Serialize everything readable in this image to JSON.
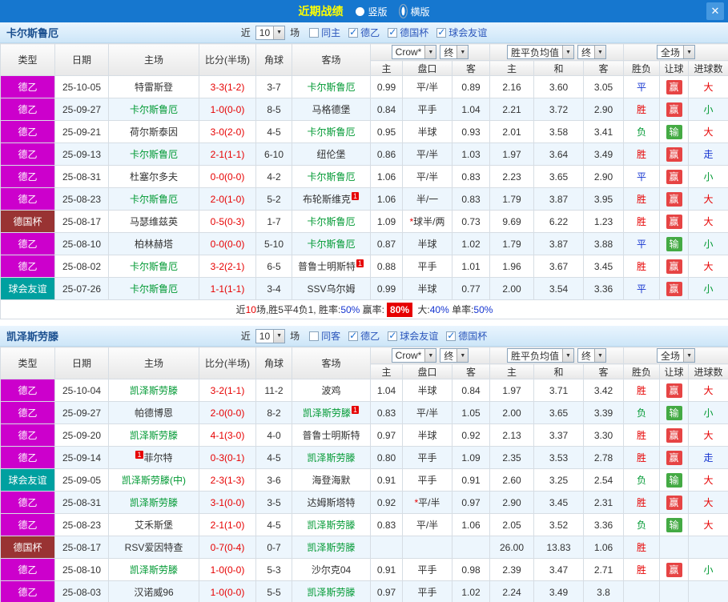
{
  "topbar": {
    "title": "近期战绩",
    "radio_options": [
      {
        "label": "竖版",
        "selected": false
      },
      {
        "label": "横版",
        "selected": true
      }
    ],
    "close_label": "✕"
  },
  "filter": {
    "near": "近",
    "count": "10",
    "games": "场"
  },
  "columns": {
    "type": "类型",
    "date": "日期",
    "home": "主场",
    "score": "比分(半场)",
    "corner": "角球",
    "away": "客场",
    "odds_company": "Crow*",
    "final": "终",
    "odds_home": "主",
    "handicap": "盘口",
    "odds_away": "客",
    "avg_label": "胜平负均值",
    "avg_home": "主",
    "avg_draw": "和",
    "avg_away": "客",
    "scope": "全场",
    "result": "胜负",
    "let_col": "让球",
    "goals": "进球数"
  },
  "colors": {
    "topbar-bg": "#1677cf",
    "title-yellow": "#ffff00",
    "league-magenta": "#cc00cc",
    "cup-maroon": "#993333",
    "friendly-teal": "#00a0a0",
    "focus-green": "#009933",
    "score-red": "#e60000",
    "win-red": "#e64444",
    "lose-green": "#44aa44",
    "text-blue": "#1535d0",
    "teambar-blue": "#1a4f8f"
  },
  "sections": [
    {
      "team": "卡尔斯鲁厄",
      "checkboxes": [
        {
          "label": "同主",
          "checked": false
        },
        {
          "label": "德乙",
          "checked": true
        },
        {
          "label": "德国杯",
          "checked": true
        },
        {
          "label": "球会友谊",
          "checked": true
        }
      ],
      "rows": [
        {
          "type": "德乙",
          "date": "25-10-05",
          "home": {
            "text": "特雷斯登",
            "focus": false,
            "badge": "",
            "badge_pos": ""
          },
          "score": "3-3(1-2)",
          "corner": "3-7",
          "away": {
            "text": "卡尔斯鲁厄",
            "focus": true,
            "badge": "",
            "badge_pos": ""
          },
          "odds": [
            "0.99",
            "平/半",
            "0.89"
          ],
          "avg": [
            "2.16",
            "3.60",
            "3.05"
          ],
          "result": {
            "text": "平",
            "color": "blue"
          },
          "let": {
            "text": "赢",
            "color": "red"
          },
          "goal": {
            "text": "大",
            "color": "red"
          }
        },
        {
          "type": "德乙",
          "date": "25-09-27",
          "home": {
            "text": "卡尔斯鲁厄",
            "focus": true,
            "badge": "",
            "badge_pos": ""
          },
          "score": "1-0(0-0)",
          "corner": "8-5",
          "away": {
            "text": "马格德堡",
            "focus": false,
            "badge": "",
            "badge_pos": ""
          },
          "odds": [
            "0.84",
            "平手",
            "1.04"
          ],
          "avg": [
            "2.21",
            "3.72",
            "2.90"
          ],
          "result": {
            "text": "胜",
            "color": "red"
          },
          "let": {
            "text": "赢",
            "color": "red"
          },
          "goal": {
            "text": "小",
            "color": "green"
          }
        },
        {
          "type": "德乙",
          "date": "25-09-21",
          "home": {
            "text": "荷尔斯泰因",
            "focus": false,
            "badge": "",
            "badge_pos": ""
          },
          "score": "3-0(2-0)",
          "corner": "4-5",
          "away": {
            "text": "卡尔斯鲁厄",
            "focus": true,
            "badge": "",
            "badge_pos": ""
          },
          "odds": [
            "0.95",
            "半球",
            "0.93"
          ],
          "avg": [
            "2.01",
            "3.58",
            "3.41"
          ],
          "result": {
            "text": "负",
            "color": "green"
          },
          "let": {
            "text": "输",
            "color": "green"
          },
          "goal": {
            "text": "大",
            "color": "red"
          }
        },
        {
          "type": "德乙",
          "date": "25-09-13",
          "home": {
            "text": "卡尔斯鲁厄",
            "focus": true,
            "badge": "",
            "badge_pos": ""
          },
          "score": "2-1(1-1)",
          "corner": "6-10",
          "away": {
            "text": "纽伦堡",
            "focus": false,
            "badge": "",
            "badge_pos": ""
          },
          "odds": [
            "0.86",
            "平/半",
            "1.03"
          ],
          "avg": [
            "1.97",
            "3.64",
            "3.49"
          ],
          "result": {
            "text": "胜",
            "color": "red"
          },
          "let": {
            "text": "赢",
            "color": "red"
          },
          "goal": {
            "text": "走",
            "color": "blue"
          }
        },
        {
          "type": "德乙",
          "date": "25-08-31",
          "home": {
            "text": "杜塞尔多夫",
            "focus": false,
            "badge": "",
            "badge_pos": ""
          },
          "score": "0-0(0-0)",
          "corner": "4-2",
          "away": {
            "text": "卡尔斯鲁厄",
            "focus": true,
            "badge": "",
            "badge_pos": ""
          },
          "odds": [
            "1.06",
            "平/半",
            "0.83"
          ],
          "avg": [
            "2.23",
            "3.65",
            "2.90"
          ],
          "result": {
            "text": "平",
            "color": "blue"
          },
          "let": {
            "text": "赢",
            "color": "red"
          },
          "goal": {
            "text": "小",
            "color": "green"
          }
        },
        {
          "type": "德乙",
          "date": "25-08-23",
          "home": {
            "text": "卡尔斯鲁厄",
            "focus": true,
            "badge": "",
            "badge_pos": ""
          },
          "score": "2-0(1-0)",
          "corner": "5-2",
          "away": {
            "text": "布轮斯维克",
            "focus": false,
            "badge": "1",
            "badge_pos": "after"
          },
          "odds": [
            "1.06",
            "半/一",
            "0.83"
          ],
          "avg": [
            "1.79",
            "3.87",
            "3.95"
          ],
          "result": {
            "text": "胜",
            "color": "red"
          },
          "let": {
            "text": "赢",
            "color": "red"
          },
          "goal": {
            "text": "大",
            "color": "red"
          }
        },
        {
          "type": "德国杯",
          "date": "25-08-17",
          "home": {
            "text": "马瑟维兹英",
            "focus": false,
            "badge": "",
            "badge_pos": ""
          },
          "score": "0-5(0-3)",
          "corner": "1-7",
          "away": {
            "text": "卡尔斯鲁厄",
            "focus": true,
            "badge": "",
            "badge_pos": ""
          },
          "odds": [
            "1.09",
            "*球半/两",
            "0.73"
          ],
          "avg": [
            "9.69",
            "6.22",
            "1.23"
          ],
          "result": {
            "text": "胜",
            "color": "red"
          },
          "let": {
            "text": "赢",
            "color": "red"
          },
          "goal": {
            "text": "大",
            "color": "red"
          }
        },
        {
          "type": "德乙",
          "date": "25-08-10",
          "home": {
            "text": "柏林赫塔",
            "focus": false,
            "badge": "",
            "badge_pos": ""
          },
          "score": "0-0(0-0)",
          "corner": "5-10",
          "away": {
            "text": "卡尔斯鲁厄",
            "focus": true,
            "badge": "",
            "badge_pos": ""
          },
          "odds": [
            "0.87",
            "半球",
            "1.02"
          ],
          "avg": [
            "1.79",
            "3.87",
            "3.88"
          ],
          "result": {
            "text": "平",
            "color": "blue"
          },
          "let": {
            "text": "输",
            "color": "green"
          },
          "goal": {
            "text": "小",
            "color": "green"
          }
        },
        {
          "type": "德乙",
          "date": "25-08-02",
          "home": {
            "text": "卡尔斯鲁厄",
            "focus": true,
            "badge": "",
            "badge_pos": ""
          },
          "score": "3-2(2-1)",
          "corner": "6-5",
          "away": {
            "text": "普鲁士明斯特",
            "focus": false,
            "badge": "1",
            "badge_pos": "after"
          },
          "odds": [
            "0.88",
            "平手",
            "1.01"
          ],
          "avg": [
            "1.96",
            "3.67",
            "3.45"
          ],
          "result": {
            "text": "胜",
            "color": "red"
          },
          "let": {
            "text": "赢",
            "color": "red"
          },
          "goal": {
            "text": "大",
            "color": "red"
          }
        },
        {
          "type": "球会友谊",
          "date": "25-07-26",
          "home": {
            "text": "卡尔斯鲁厄",
            "focus": true,
            "badge": "",
            "badge_pos": ""
          },
          "score": "1-1(1-1)",
          "corner": "3-4",
          "away": {
            "text": "SSV乌尔姆",
            "focus": false,
            "badge": "",
            "badge_pos": ""
          },
          "odds": [
            "0.99",
            "半球",
            "0.77"
          ],
          "avg": [
            "2.00",
            "3.54",
            "3.36"
          ],
          "result": {
            "text": "平",
            "color": "blue"
          },
          "let": {
            "text": "赢",
            "color": "red"
          },
          "goal": {
            "text": "小",
            "color": "green"
          }
        }
      ],
      "summary": [
        {
          "text": "近",
          "style": "plain"
        },
        {
          "text": "10",
          "style": "red"
        },
        {
          "text": "场,胜5平4负1, 胜率:",
          "style": "plain"
        },
        {
          "text": "50%",
          "style": "blue"
        },
        {
          "text": " 赢率:",
          "style": "plain"
        },
        {
          "text": "80%",
          "style": "red-badge"
        },
        {
          "text": " 大:",
          "style": "plain"
        },
        {
          "text": "40%",
          "style": "blue"
        },
        {
          "text": " 单率:",
          "style": "plain"
        },
        {
          "text": "50%",
          "style": "blue"
        }
      ]
    },
    {
      "team": "凯泽斯劳滕",
      "checkboxes": [
        {
          "label": "同客",
          "checked": false
        },
        {
          "label": "德乙",
          "checked": true
        },
        {
          "label": "球会友谊",
          "checked": true
        },
        {
          "label": "德国杯",
          "checked": true
        }
      ],
      "rows": [
        {
          "type": "德乙",
          "date": "25-10-04",
          "home": {
            "text": "凯泽斯劳滕",
            "focus": true,
            "badge": "",
            "badge_pos": ""
          },
          "score": "3-2(1-1)",
          "corner": "11-2",
          "away": {
            "text": "波鸡",
            "focus": false,
            "badge": "",
            "badge_pos": ""
          },
          "odds": [
            "1.04",
            "半球",
            "0.84"
          ],
          "avg": [
            "1.97",
            "3.71",
            "3.42"
          ],
          "result": {
            "text": "胜",
            "color": "red"
          },
          "let": {
            "text": "赢",
            "color": "red"
          },
          "goal": {
            "text": "大",
            "color": "red"
          }
        },
        {
          "type": "德乙",
          "date": "25-09-27",
          "home": {
            "text": "帕德博恩",
            "focus": false,
            "badge": "",
            "badge_pos": ""
          },
          "score": "2-0(0-0)",
          "corner": "8-2",
          "away": {
            "text": "凯泽斯劳滕",
            "focus": true,
            "badge": "1",
            "badge_pos": "after"
          },
          "odds": [
            "0.83",
            "平/半",
            "1.05"
          ],
          "avg": [
            "2.00",
            "3.65",
            "3.39"
          ],
          "result": {
            "text": "负",
            "color": "green"
          },
          "let": {
            "text": "输",
            "color": "green"
          },
          "goal": {
            "text": "小",
            "color": "green"
          }
        },
        {
          "type": "德乙",
          "date": "25-09-20",
          "home": {
            "text": "凯泽斯劳滕",
            "focus": true,
            "badge": "",
            "badge_pos": ""
          },
          "score": "4-1(3-0)",
          "corner": "4-0",
          "away": {
            "text": "普鲁士明斯特",
            "focus": false,
            "badge": "",
            "badge_pos": ""
          },
          "odds": [
            "0.97",
            "半球",
            "0.92"
          ],
          "avg": [
            "2.13",
            "3.37",
            "3.30"
          ],
          "result": {
            "text": "胜",
            "color": "red"
          },
          "let": {
            "text": "赢",
            "color": "red"
          },
          "goal": {
            "text": "大",
            "color": "red"
          }
        },
        {
          "type": "德乙",
          "date": "25-09-14",
          "home": {
            "text": "菲尔特",
            "focus": false,
            "badge": "1",
            "badge_pos": "before"
          },
          "score": "0-3(0-1)",
          "corner": "4-5",
          "away": {
            "text": "凯泽斯劳滕",
            "focus": true,
            "badge": "",
            "badge_pos": ""
          },
          "odds": [
            "0.80",
            "平手",
            "1.09"
          ],
          "avg": [
            "2.35",
            "3.53",
            "2.78"
          ],
          "result": {
            "text": "胜",
            "color": "red"
          },
          "let": {
            "text": "赢",
            "color": "red"
          },
          "goal": {
            "text": "走",
            "color": "blue"
          }
        },
        {
          "type": "球会友谊",
          "date": "25-09-05",
          "home": {
            "text": "凯泽斯劳滕(中)",
            "focus": true,
            "badge": "",
            "badge_pos": ""
          },
          "score": "2-3(1-3)",
          "corner": "3-6",
          "away": {
            "text": "海登海默",
            "focus": false,
            "badge": "",
            "badge_pos": ""
          },
          "odds": [
            "0.91",
            "平手",
            "0.91"
          ],
          "avg": [
            "2.60",
            "3.25",
            "2.54"
          ],
          "result": {
            "text": "负",
            "color": "green"
          },
          "let": {
            "text": "输",
            "color": "green"
          },
          "goal": {
            "text": "大",
            "color": "red"
          }
        },
        {
          "type": "德乙",
          "date": "25-08-31",
          "home": {
            "text": "凯泽斯劳滕",
            "focus": true,
            "badge": "",
            "badge_pos": ""
          },
          "score": "3-1(0-0)",
          "corner": "3-5",
          "away": {
            "text": "达姆斯塔特",
            "focus": false,
            "badge": "",
            "badge_pos": ""
          },
          "odds": [
            "0.92",
            "*平/半",
            "0.97"
          ],
          "avg": [
            "2.90",
            "3.45",
            "2.31"
          ],
          "result": {
            "text": "胜",
            "color": "red"
          },
          "let": {
            "text": "赢",
            "color": "red"
          },
          "goal": {
            "text": "大",
            "color": "red"
          }
        },
        {
          "type": "德乙",
          "date": "25-08-23",
          "home": {
            "text": "艾禾斯堡",
            "focus": false,
            "badge": "",
            "badge_pos": ""
          },
          "score": "2-1(1-0)",
          "corner": "4-5",
          "away": {
            "text": "凯泽斯劳滕",
            "focus": true,
            "badge": "",
            "badge_pos": ""
          },
          "odds": [
            "0.83",
            "平/半",
            "1.06"
          ],
          "avg": [
            "2.05",
            "3.52",
            "3.36"
          ],
          "result": {
            "text": "负",
            "color": "green"
          },
          "let": {
            "text": "输",
            "color": "green"
          },
          "goal": {
            "text": "大",
            "color": "red"
          }
        },
        {
          "type": "德国杯",
          "date": "25-08-17",
          "home": {
            "text": "RSV爱因特查",
            "focus": false,
            "badge": "",
            "badge_pos": ""
          },
          "score": "0-7(0-4)",
          "corner": "0-7",
          "away": {
            "text": "凯泽斯劳滕",
            "focus": true,
            "badge": "",
            "badge_pos": ""
          },
          "odds": [
            "",
            "",
            ""
          ],
          "avg": [
            "26.00",
            "13.83",
            "1.06"
          ],
          "result": {
            "text": "胜",
            "color": "red"
          },
          "let": {
            "text": "",
            "color": ""
          },
          "goal": {
            "text": "",
            "color": ""
          }
        },
        {
          "type": "德乙",
          "date": "25-08-10",
          "home": {
            "text": "凯泽斯劳滕",
            "focus": true,
            "badge": "",
            "badge_pos": ""
          },
          "score": "1-0(0-0)",
          "corner": "5-3",
          "away": {
            "text": "沙尔克04",
            "focus": false,
            "badge": "",
            "badge_pos": ""
          },
          "odds": [
            "0.91",
            "平手",
            "0.98"
          ],
          "avg": [
            "2.39",
            "3.47",
            "2.71"
          ],
          "result": {
            "text": "胜",
            "color": "red"
          },
          "let": {
            "text": "赢",
            "color": "red"
          },
          "goal": {
            "text": "小",
            "color": "green"
          }
        },
        {
          "type": "德乙",
          "date": "25-08-03",
          "home": {
            "text": "汉诺威96",
            "focus": false,
            "badge": "",
            "badge_pos": ""
          },
          "score": "1-0(0-0)",
          "corner": "5-5",
          "away": {
            "text": "凯泽斯劳滕",
            "focus": true,
            "badge": "",
            "badge_pos": ""
          },
          "odds": [
            "0.97",
            "平手",
            "1.02"
          ],
          "avg": [
            "2.24",
            "3.49",
            "3.8"
          ],
          "result": {
            "text": "",
            "color": ""
          },
          "let": {
            "text": "",
            "color": ""
          },
          "goal": {
            "text": "",
            "color": ""
          }
        }
      ],
      "summary": null
    }
  ]
}
